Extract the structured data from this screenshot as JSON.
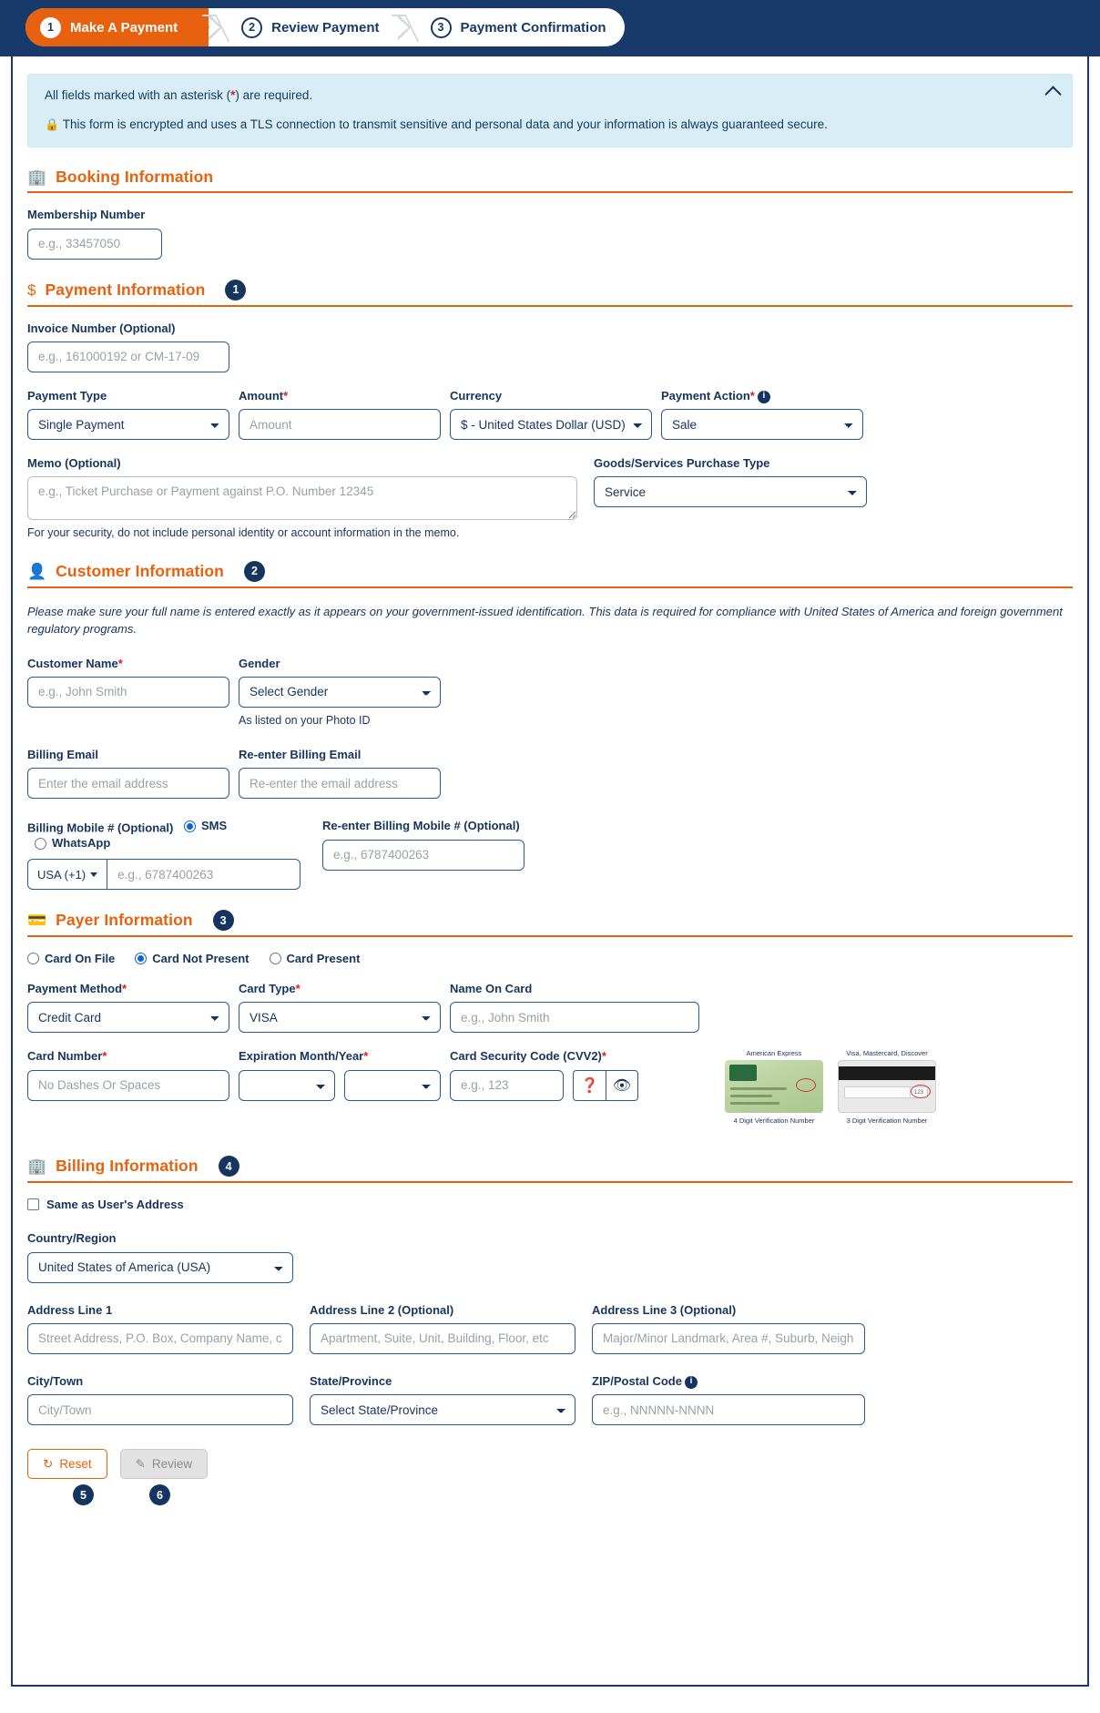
{
  "wizard": {
    "steps": [
      {
        "num": "1",
        "label": "Make A Payment",
        "active": true
      },
      {
        "num": "2",
        "label": "Review Payment",
        "active": false
      },
      {
        "num": "3",
        "label": "Payment Confirmation",
        "active": false
      }
    ]
  },
  "notice": {
    "line1_pre": "All fields marked with an asterisk (",
    "line1_star": "*",
    "line1_post": ") are required.",
    "lock_icon": "lock-icon",
    "line2": "This form is encrypted and uses a TLS connection to transmit sensitive and personal data and your information is always guaranteed secure.",
    "collapse_icon": "chevron-up-icon"
  },
  "booking": {
    "icon": "building-icon",
    "title": "Booking Information",
    "membership_label": "Membership Number",
    "membership_placeholder": "e.g., 33457050",
    "membership_value": ""
  },
  "payment": {
    "icon": "dollar-icon",
    "title": "Payment Information",
    "badge": "1",
    "invoice_label": "Invoice Number (Optional)",
    "invoice_placeholder": "e.g., 161000192 or CM-17-09",
    "payment_type_label": "Payment Type",
    "payment_type_value": "Single Payment",
    "amount_label": "Amount",
    "amount_placeholder": "Amount",
    "currency_label": "Currency",
    "currency_value": "$ - United States Dollar (USD)",
    "payment_action_label": "Payment Action",
    "payment_action_value": "Sale",
    "memo_label": "Memo (Optional)",
    "memo_placeholder": "e.g., Ticket Purchase or Payment against P.O. Number 12345",
    "memo_help": "For your security, do not include personal identity or account information in the memo.",
    "goods_label": "Goods/Services Purchase Type",
    "goods_value": "Service"
  },
  "customer": {
    "icon": "person-icon",
    "title": "Customer Information",
    "badge": "2",
    "note": "Please make sure your full name is entered exactly as it appears on your government-issued identification. This data is required for compliance with United States of America and foreign government regulatory programs.",
    "name_label": "Customer Name",
    "name_placeholder": "e.g., John Smith",
    "gender_label": "Gender",
    "gender_value": "Select Gender",
    "gender_help": "As listed on your Photo ID",
    "email_label": "Billing Email",
    "email_placeholder": "Enter the email address",
    "email2_label": "Re-enter Billing Email",
    "email2_placeholder": "Re-enter the email address",
    "mobile_label": "Billing Mobile # (Optional)",
    "sms_label": "SMS",
    "whatsapp_label": "WhatsApp",
    "country_code": "USA (+1)",
    "mobile_placeholder": "e.g., 6787400263",
    "mobile2_label": "Re-enter Billing Mobile # (Optional)",
    "mobile2_placeholder": "e.g., 6787400263"
  },
  "payer": {
    "icon": "card-icon",
    "title": "Payer Information",
    "badge": "3",
    "card_on_file": "Card On File",
    "card_not_present": "Card Not Present",
    "card_present": "Card Present",
    "method_label": "Payment Method",
    "method_value": "Credit Card",
    "cardtype_label": "Card Type",
    "cardtype_value": "VISA",
    "nameoncard_label": "Name On Card",
    "nameoncard_placeholder": "e.g., John Smith",
    "cardnumber_label": "Card Number",
    "cardnumber_placeholder": "No Dashes Or Spaces",
    "expiry_label": "Expiration Month/Year",
    "exp_month_value": "",
    "exp_year_value": "",
    "cvv_label": "Card Security Code (CVV2)",
    "cvv_placeholder": "e.g., 123",
    "help_icon": "question-icon",
    "eye_icon": "eye-icon",
    "amex_caption": "American Express",
    "amex_caption_bottom": "4 Digit Verification Number",
    "visa_caption": "Visa, Mastercard, Discover",
    "visa_caption_bottom": "3 Digit Verification Number"
  },
  "billing": {
    "icon": "building-icon",
    "title": "Billing Information",
    "badge": "4",
    "same_address_label": "Same as User's Address",
    "country_label": "Country/Region",
    "country_value": "United States of America (USA)",
    "addr1_label": "Address Line 1",
    "addr1_placeholder": "Street Address, P.O. Box, Company Name, c/o",
    "addr2_label": "Address Line 2 (Optional)",
    "addr2_placeholder": "Apartment, Suite, Unit, Building, Floor, etc",
    "addr3_label": "Address Line 3 (Optional)",
    "addr3_placeholder": "Major/Minor Landmark, Area #, Suburb, Neighborhood",
    "city_label": "City/Town",
    "city_placeholder": "City/Town",
    "state_label": "State/Province",
    "state_value": "Select State/Province",
    "zip_label": "ZIP/Postal Code",
    "zip_placeholder": "e.g., NNNNN-NNNN"
  },
  "actions": {
    "reset_label": "Reset",
    "reset_icon": "refresh-icon",
    "review_label": "Review",
    "review_icon": "pencil-icon",
    "reset_badge": "5",
    "review_badge": "6"
  },
  "colors": {
    "brand_orange": "#e8610f",
    "brand_navy": "#173a6a",
    "required_red": "#e21b1b",
    "notice_bg": "#d9edf7"
  }
}
